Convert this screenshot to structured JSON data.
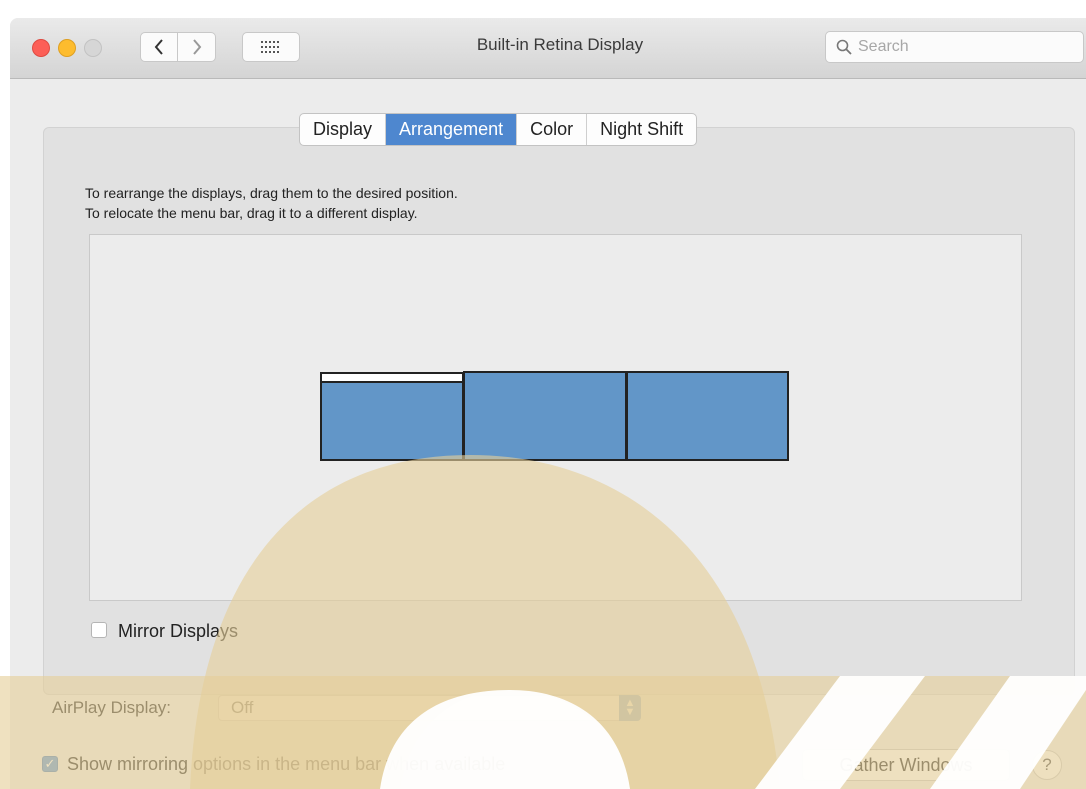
{
  "window": {
    "title": "Built-in Retina Display"
  },
  "search": {
    "placeholder": "Search"
  },
  "tabs": [
    {
      "label": "Display",
      "active": false
    },
    {
      "label": "Arrangement",
      "active": true
    },
    {
      "label": "Color",
      "active": false
    },
    {
      "label": "Night Shift",
      "active": false
    }
  ],
  "instructions": {
    "line1": "To rearrange the displays, drag them to the desired position.",
    "line2": "To relocate the menu bar, drag it to a different display."
  },
  "arrangement": {
    "display_count": 3,
    "menu_bar_on_display": 1
  },
  "mirror_displays": {
    "label": "Mirror Displays",
    "checked": false
  },
  "airplay": {
    "label": "AirPlay Display:",
    "value": "Off"
  },
  "show_mirroring": {
    "label": "Show mirroring options in the menu bar when available",
    "checked": true
  },
  "buttons": {
    "gather_windows": "Gather Windows",
    "help": "?"
  },
  "icons": {
    "back": "chevron-left-icon",
    "forward": "chevron-right-icon",
    "show_all": "grid-icon",
    "search": "magnifying-glass-icon"
  },
  "colors": {
    "accent": "#4e87cf",
    "display": "#6296c8",
    "watermark": "#e5cf9a"
  }
}
